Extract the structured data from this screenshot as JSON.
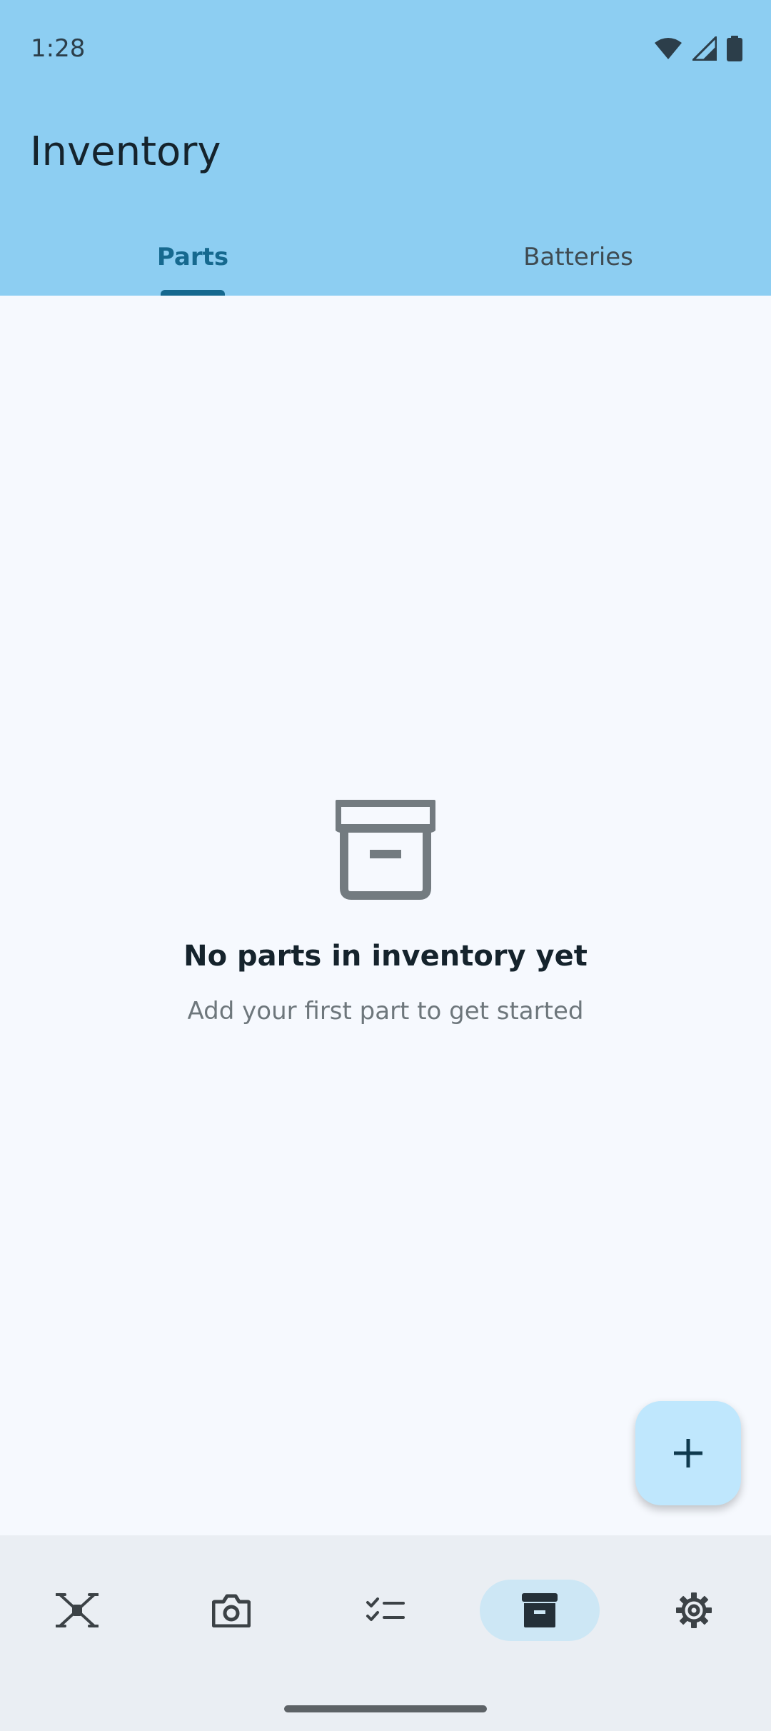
{
  "status_bar": {
    "time": "1:28",
    "icons": [
      "wifi-icon",
      "signal-icon",
      "battery-icon"
    ]
  },
  "app_bar": {
    "title": "Inventory"
  },
  "tabs": [
    {
      "label": "Parts",
      "active": true
    },
    {
      "label": "Batteries",
      "active": false
    }
  ],
  "empty_state": {
    "icon": "archive-icon",
    "title": "No parts in inventory yet",
    "subtitle": "Add your first part to get started"
  },
  "fab": {
    "icon": "plus-icon"
  },
  "bottom_nav": {
    "items": [
      {
        "icon": "drone-icon",
        "active": false
      },
      {
        "icon": "camera-icon",
        "active": false
      },
      {
        "icon": "checklist-icon",
        "active": false
      },
      {
        "icon": "archive-icon",
        "active": true
      },
      {
        "icon": "gear-icon",
        "active": false
      }
    ]
  },
  "colors": {
    "app_bar": "#8DCEF2",
    "accent": "#16698F",
    "background": "#F6F9FE",
    "nav_background": "#EAEEF3",
    "fab": "#BFE7FD"
  }
}
